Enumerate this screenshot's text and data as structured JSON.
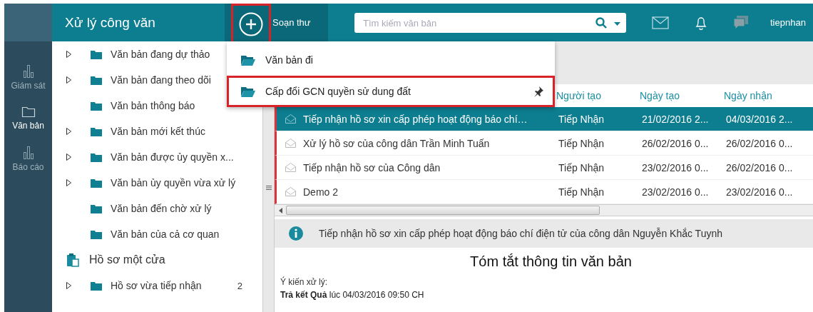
{
  "header": {
    "title": "Xử lý công văn",
    "compose": {
      "label": "Soạn thư",
      "highlighted": true
    },
    "search": {
      "placeholder": "Tìm kiếm văn bản"
    },
    "user": "tiepnhan"
  },
  "rail": [
    {
      "label": "Giám sát",
      "selected": false
    },
    {
      "label": "Văn bản",
      "selected": true
    },
    {
      "label": "Báo cáo",
      "selected": false
    }
  ],
  "tree": [
    {
      "kind": "folder",
      "label": "Văn bản đang dự thảo",
      "expandable": true
    },
    {
      "kind": "folder",
      "label": "Văn bản đang theo dõi",
      "expandable": true
    },
    {
      "kind": "folder",
      "label": "Văn bản thông báo",
      "expandable": false
    },
    {
      "kind": "folder",
      "label": "Văn bản mới kết thúc",
      "expandable": true
    },
    {
      "kind": "folder",
      "label": "Văn bản được ủy quyền x...",
      "expandable": true
    },
    {
      "kind": "folder",
      "label": "Văn bản ủy quyền vừa xử lý",
      "expandable": true
    },
    {
      "kind": "folder",
      "label": "Văn bản đến chờ xử lý",
      "expandable": false
    },
    {
      "kind": "folder",
      "label": "Văn bản của cả cơ quan",
      "expandable": false
    },
    {
      "kind": "section",
      "label": "Hồ sơ một cửa"
    },
    {
      "kind": "folder",
      "label": "Hồ sơ vừa tiếp nhận",
      "expandable": true,
      "count": "2"
    }
  ],
  "compose_menu": [
    {
      "label": "Văn bản đi",
      "highlighted": false,
      "pinned": false
    },
    {
      "label": "Cấp đổi GCN quyền sử dung đất",
      "highlighted": true,
      "pinned": true
    }
  ],
  "table": {
    "columns": [
      "",
      "Người tạo",
      "Ngày tạo",
      "Ngày nhận"
    ],
    "rows": [
      {
        "selected": true,
        "unread": true,
        "cells": [
          "Tiếp nhận hồ sơ xin cấp phép hoạt động báo chí…",
          "Tiếp Nhận",
          "21/02/2016 2...",
          "04/03/2016 2..."
        ]
      },
      {
        "selected": false,
        "unread": true,
        "cells": [
          "Xử lý hồ sơ của công dân Trần Minh Tuấn",
          "Tiếp Nhận",
          "26/02/2016 0...",
          "26/02/2016 0..."
        ]
      },
      {
        "selected": false,
        "unread": true,
        "cells": [
          "Tiếp nhận hồ sơ của Công dân",
          "Tiếp Nhận",
          "23/02/2016 0...",
          "26/02/2016 0..."
        ]
      },
      {
        "selected": false,
        "unread": true,
        "cells": [
          "Demo 2",
          "Tiếp Nhận",
          "23/02/2016 0...",
          "23/02/2016 0..."
        ]
      }
    ]
  },
  "detail": {
    "info": "Tiếp nhận hồ sơ xin cấp phép hoạt động báo chí điện tử của công dân Nguyễn Khắc Tuynh",
    "title": "Tóm tắt thông tin văn bản",
    "opinion_label": "Ý kiến xử lý:",
    "result": "**Trả kết Quả** lúc 04/03/2016 09:50 CH"
  }
}
